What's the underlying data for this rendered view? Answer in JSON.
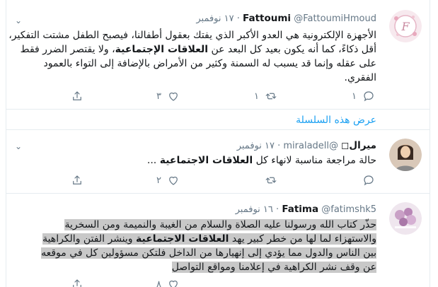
{
  "tweets": [
    {
      "name": "Fattoumi",
      "handle": "@FattoumiHmoud",
      "time": "١٧ نوفمبر",
      "dot": "·",
      "text_part1": "الأجهزة الإلكترونية هي العدو الأكبر الذي يفتك بعقول أطفالنا، فيصبح الطفل مشتت التفكير، أقل ذكاءً، كما أنه يكون بعيد كل البعد عن ",
      "text_bold": "العلاقات الإجتماعية",
      "text_part2": "، ولا يقتصر الضرر فقط على عقله وإنما قد يسبب له السمنة وكثير من الأمراض بالإضافة إلى التواء بالعمود الفقري.",
      "reply_count": "١",
      "retweet_count": "١",
      "like_count": "٣",
      "thread_link": "عرض هذه السلسلة"
    },
    {
      "name": "ميرال",
      "name_prefix": "◻",
      "handle": "@miraladell",
      "time": "١٧ نوفمبر",
      "dot": "·",
      "text_part1": "حالة مراجعة مناسبة لانهاء كل ",
      "text_bold": "العلاقات الاجتماعية",
      "text_part2": " ...",
      "reply_count": "",
      "retweet_count": "",
      "like_count": "٢"
    },
    {
      "name": "Fatima",
      "handle": "@fatimshk5",
      "time": "١٦ نوفمبر",
      "dot": "·",
      "line1": "حذّر كتاب الله ورسولنا عليه الصلاة والسلام من الغيبة والنميمة ومن السخرية",
      "line2a": "والاستهزاء لما لها من خطر كبير يهد ",
      "line2bold": "العلاقات الاجتماعية",
      "line2b": " وينشر الفتن والكراهية",
      "line3": "بين الناس والدول  مما يؤدي إلى إنهيارها من الداخل فلتكن مسؤولين كل في موقعه",
      "line4": "عن وقف نشر الكراهية في إعلامنا ومواقع التواصل",
      "like_count": "٨"
    }
  ]
}
